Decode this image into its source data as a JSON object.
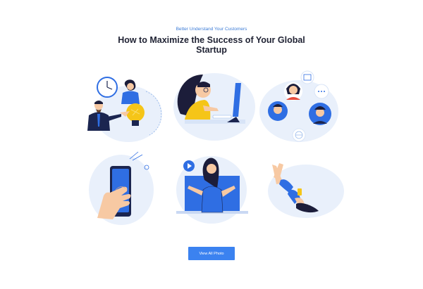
{
  "header": {
    "eyebrow": "Better Understand Your Customers",
    "title": "How to Maximize the Success of Your Global Startup"
  },
  "gallery": {
    "illustrations": [
      "clock-lightbulb-businessman-illustration",
      "woman-at-computer-illustration",
      "team-video-call-illustration",
      "hand-holding-smartphone-illustration",
      "woman-from-laptop-screen-illustration",
      "woman-flying-with-phone-illustration"
    ]
  },
  "cta": {
    "label": "View All Photo"
  },
  "colors": {
    "accent": "#3b82f0",
    "blob": "#e6eefb",
    "skin": "#f7c9a3",
    "hair": "#1c1d3a",
    "yellow": "#f5c518",
    "blue": "#2f6ee3",
    "navy": "#1b2550"
  }
}
